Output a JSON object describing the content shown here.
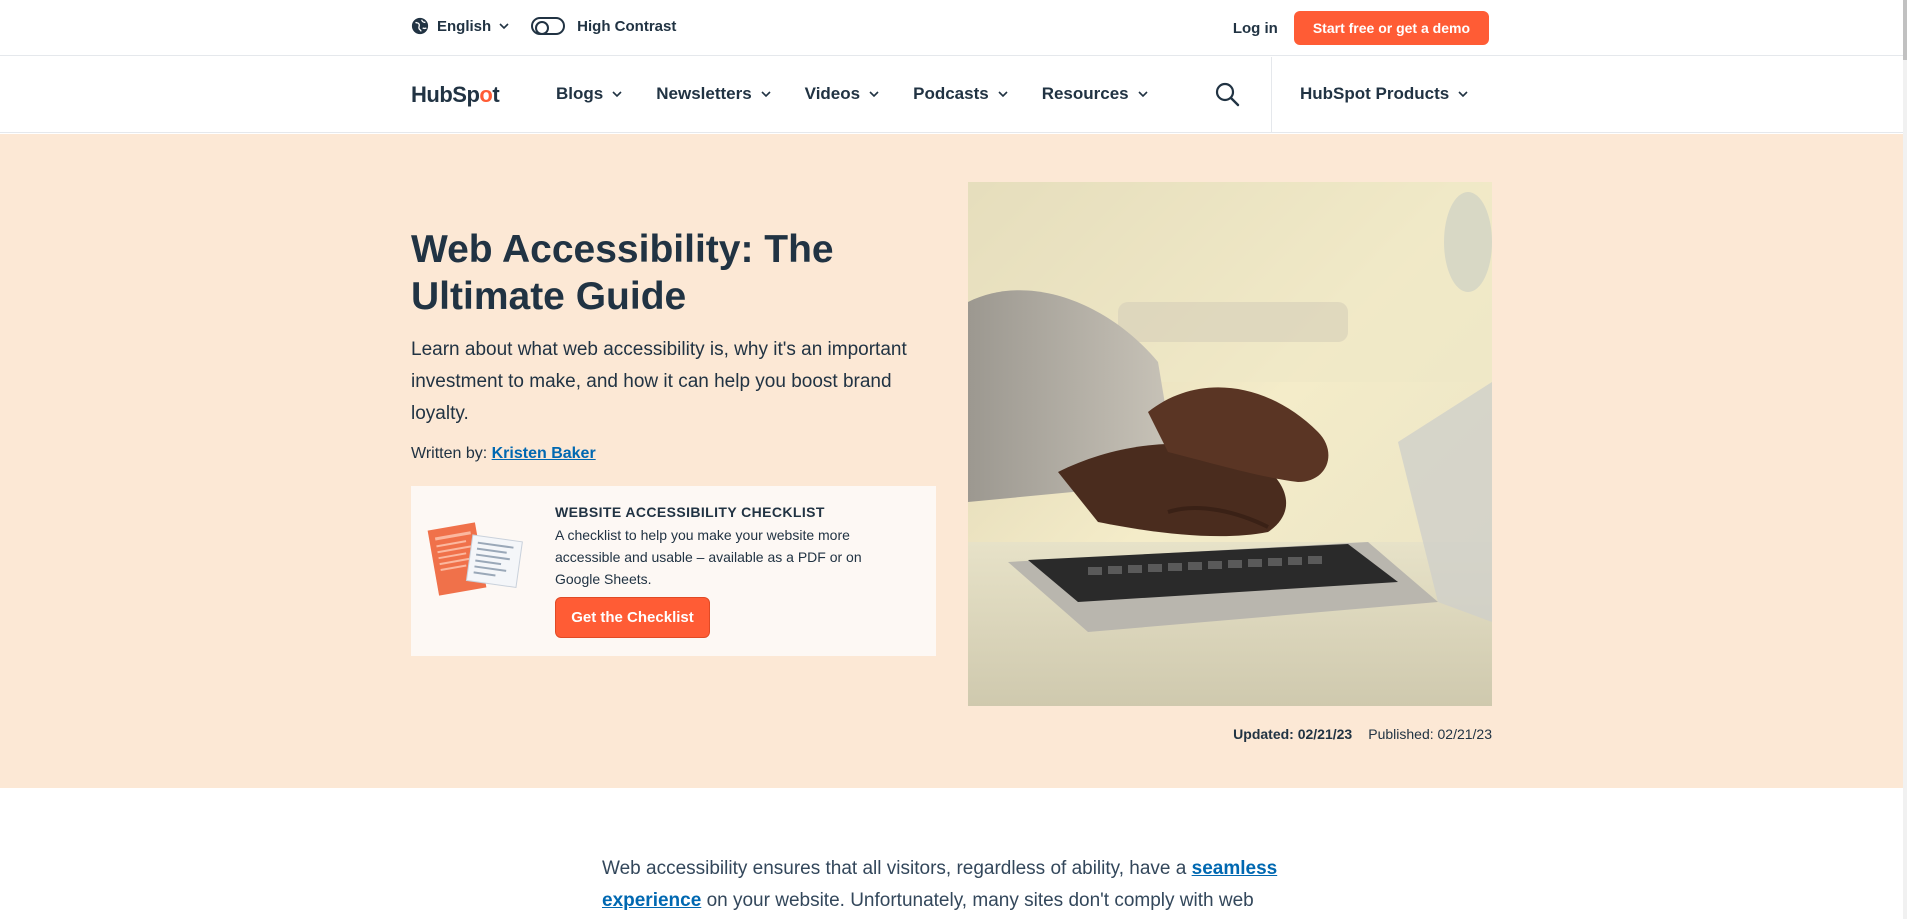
{
  "utility": {
    "language_label": "English",
    "contrast_label": "High Contrast",
    "login_label": "Log in",
    "cta_label": "Start free or get a demo"
  },
  "nav": {
    "logo_pre": "HubSp",
    "logo_spot": "o",
    "logo_post": "t",
    "items": [
      {
        "label": "Blogs"
      },
      {
        "label": "Newsletters"
      },
      {
        "label": "Videos"
      },
      {
        "label": "Podcasts"
      },
      {
        "label": "Resources"
      }
    ],
    "products_label": "HubSpot Products",
    "search_icon": "search-icon"
  },
  "hero": {
    "title": "Web Accessibility: The Ultimate Guide",
    "subtitle": "Learn about what web accessibility is, why it's an important investment to make, and how it can help you boost brand loyalty.",
    "written_by_label": "Written by:",
    "author": "Kristen Baker",
    "updated": "Updated: 02/21/23",
    "published": "Published: 02/21/23"
  },
  "offer": {
    "heading": "WEBSITE ACCESSIBILITY CHECKLIST",
    "description": "A checklist to help you make your website more accessible and usable – available as a PDF or on Google Sheets.",
    "button_label": "Get the Checklist"
  },
  "article": {
    "intro_before": "Web accessibility ensures that all visitors, regardless of ability, have a ",
    "intro_link": "seamless experience",
    "intro_after": " on your website. Unfortunately, many sites don't comply with web"
  },
  "colors": {
    "accent": "#ff5c35",
    "hero_bg": "#fce8d5",
    "text": "#213343",
    "link": "#0068b1"
  }
}
